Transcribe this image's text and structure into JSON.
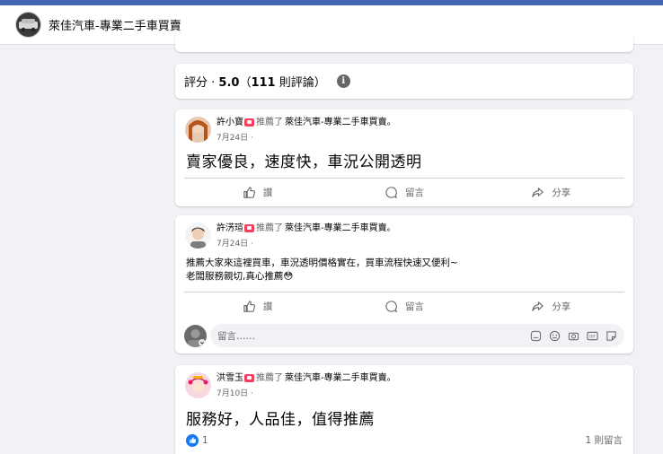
{
  "header": {
    "page_name": "萊佳汽車-專業二手車買賣"
  },
  "rating": {
    "label": "評分 · ",
    "score": "5.0",
    "count_text": "111",
    "prefix": "（",
    "suffix": " 則評論）"
  },
  "reviews": [
    {
      "author": "許小寶",
      "verb": "推薦了",
      "page": "萊佳汽車-專業二手車買賣。",
      "date": "7月24日 ·",
      "text": "賣家優良，速度快，車況公開透明",
      "actions": {
        "like": "讚",
        "comment": "留言",
        "share": "分享"
      }
    },
    {
      "author": "許淓瑄",
      "verb": "推薦了",
      "page": "萊佳汽車-專業二手車買賣。",
      "date": "7月24日 ·",
      "text_lines": [
        "推薦大家來這裡買車，車況透明價格實在，買車流程快速又便利~",
        "老闆服務親切,真心推薦😳"
      ],
      "actions": {
        "like": "讚",
        "comment": "留言",
        "share": "分享"
      },
      "comment_placeholder": "留言……"
    },
    {
      "author": "洪雪玉",
      "verb": "推薦了",
      "page": "萊佳汽車-專業二手車買賣。",
      "date": "7月10日 ·",
      "text": "服務好，人品佳，值得推薦",
      "likes": "1",
      "comments": "1 則留言"
    }
  ],
  "icons": [
    "car-logo-icon",
    "info-icon",
    "recommend-icon",
    "like-icon",
    "comment-icon",
    "share-icon",
    "sticker-icon",
    "emoji-icon",
    "camera-icon",
    "gif-icon",
    "sticker-face-icon",
    "like-badge-icon"
  ],
  "colors": {
    "brand": "#4267b2",
    "like_blue": "#1877f2",
    "recommend_red": "#f3425f",
    "muted": "#65676b"
  }
}
